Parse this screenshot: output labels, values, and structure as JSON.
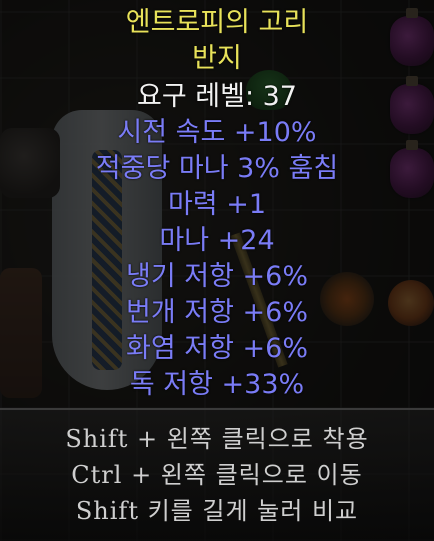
{
  "item": {
    "name": "엔트로피의 고리",
    "type": "반지",
    "requirement": "요구 레벨: 37",
    "properties": [
      "시전 속도 +10%",
      "적중당 마나 3% 훔침",
      "마력 +1",
      "마나 +24",
      "냉기 저항 +6%",
      "번개 저항 +6%",
      "화염 저항 +6%",
      "독 저항 +33%"
    ]
  },
  "hints": [
    "Shift + 왼쪽 클릭으로 착용",
    "Ctrl + 왼쪽 클릭으로 이동",
    "Shift 키를 길게 눌러 비교"
  ],
  "colors": {
    "unique_name": "#e8e25a",
    "requirement": "#f2f2f2",
    "magic_property": "#7a7cf6",
    "hint": "#cfcfcf"
  }
}
